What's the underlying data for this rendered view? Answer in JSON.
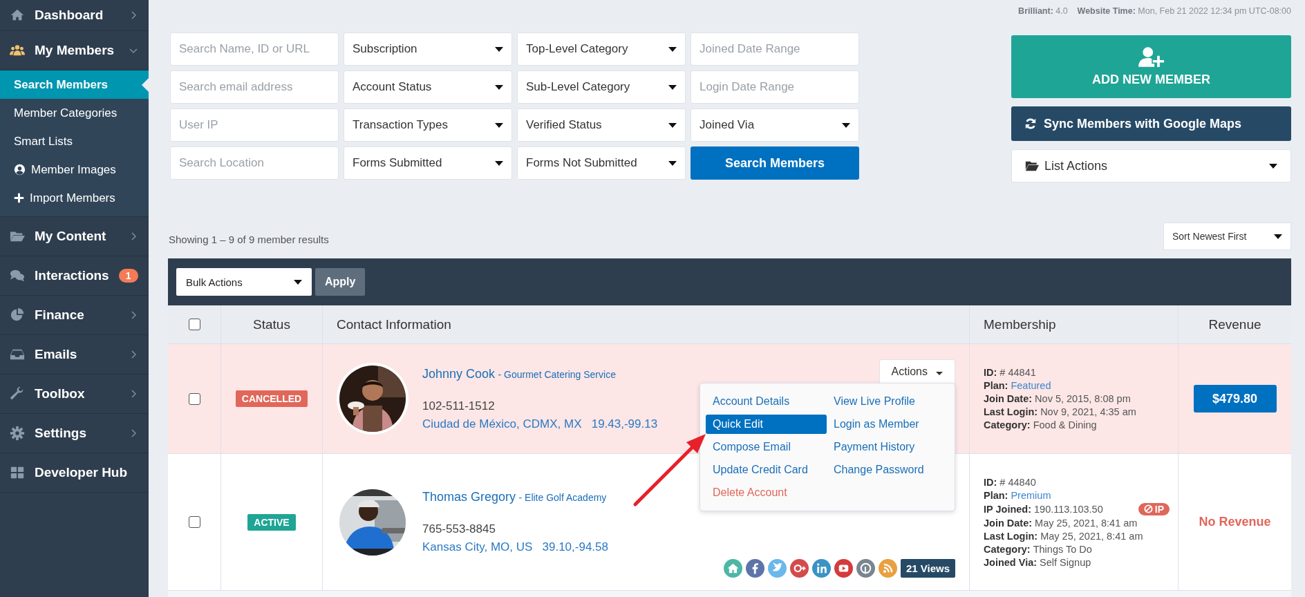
{
  "sidebar": {
    "items": [
      {
        "label": "Dashboard",
        "kind": "menu",
        "expanded": false,
        "selected": false
      },
      {
        "label": "My Members",
        "kind": "menu",
        "expanded": true,
        "selected": false,
        "children": [
          {
            "label": "Search Members",
            "selected": true
          },
          {
            "label": "Member Categories",
            "selected": false
          },
          {
            "label": "Smart Lists",
            "selected": false
          },
          {
            "label": "Member Images",
            "selected": false
          },
          {
            "label": "Import Members",
            "selected": false
          }
        ]
      },
      {
        "label": "My Content",
        "kind": "menu",
        "expanded": false,
        "selected": false
      },
      {
        "label": "Interactions",
        "kind": "link",
        "badge": "1",
        "selected": false
      },
      {
        "label": "Finance",
        "kind": "menu",
        "expanded": false,
        "selected": false
      },
      {
        "label": "Emails",
        "kind": "menu",
        "expanded": false,
        "selected": false
      },
      {
        "label": "Toolbox",
        "kind": "menu",
        "expanded": false,
        "selected": false
      },
      {
        "label": "Settings",
        "kind": "menu",
        "expanded": false,
        "selected": false
      },
      {
        "label": "Developer Hub",
        "kind": "link",
        "selected": false
      }
    ]
  },
  "top_info": {
    "version_label": "Brilliant:",
    "version": "4.0",
    "time_label": "Website Time:",
    "time": "Mon, Feb 21 2022 12:34 pm UTC-08:00"
  },
  "filters": [
    {
      "kind": "input",
      "placeholder": "Search Name, ID or URL"
    },
    {
      "kind": "select",
      "value": "Subscription"
    },
    {
      "kind": "select",
      "value": "Top-Level Category"
    },
    {
      "kind": "input",
      "placeholder": "Joined Date Range"
    },
    {
      "kind": "input",
      "placeholder": "Search email address"
    },
    {
      "kind": "select",
      "value": "Account Status"
    },
    {
      "kind": "select",
      "value": "Sub-Level Category"
    },
    {
      "kind": "input",
      "placeholder": "Login Date Range"
    },
    {
      "kind": "input",
      "placeholder": "User IP"
    },
    {
      "kind": "select",
      "value": "Transaction Types"
    },
    {
      "kind": "select",
      "value": "Verified Status"
    },
    {
      "kind": "select",
      "value": "Joined Via"
    },
    {
      "kind": "input",
      "placeholder": "Search Location"
    },
    {
      "kind": "select",
      "value": "Forms Submitted"
    },
    {
      "kind": "select",
      "value": "Forms Not Submitted"
    },
    {
      "kind": "button",
      "label": "Search Members"
    }
  ],
  "actions": {
    "add": "ADD NEW MEMBER",
    "sync": "Sync Members with Google Maps",
    "list": "List Actions"
  },
  "results": "Showing 1 – 9 of 9 member results",
  "sort": "Sort Newest First",
  "bulk": {
    "value": "Bulk Actions",
    "apply": "Apply"
  },
  "table": {
    "select_all": {
      "checked": false
    },
    "columns": [
      "Status",
      "Contact Information",
      "Membership",
      "Revenue"
    ],
    "rows": [
      {
        "checked": false,
        "highlighted": true,
        "status": "CANCELLED",
        "color": "#e0675a",
        "name": "Johnny Cook",
        "company": "- Gourmet Catering Service",
        "phone": "102-511-1512",
        "location": "Ciudad de México, CDMX, MX",
        "coords": "19.43,-99.13",
        "actions": "Actions",
        "membership": [
          {
            "label": "ID:",
            "value": "# 44841",
            "kind": "text"
          },
          {
            "label": "Plan:",
            "value": "Featured",
            "kind": "link"
          },
          {
            "label": "Join Date:",
            "value": "Nov 5, 2015, 8:08 pm",
            "kind": "text"
          },
          {
            "label": "Last Login:",
            "value": "Nov 9, 2021, 4:35 am",
            "kind": "text"
          },
          {
            "label": "Category:",
            "value": "Food & Dining",
            "kind": "text"
          }
        ],
        "revenue": {
          "kind": "button",
          "text": "$479.80"
        },
        "menu": [
          {
            "label": "Account Details",
            "kind": "link",
            "selected": false
          },
          {
            "label": "View Live Profile",
            "kind": "link",
            "selected": false
          },
          {
            "label": "Quick Edit",
            "kind": "link",
            "selected": true
          },
          {
            "label": "Login as Member",
            "kind": "link",
            "selected": false
          },
          {
            "label": "Compose Email",
            "kind": "link",
            "selected": false
          },
          {
            "label": "Payment History",
            "kind": "link",
            "selected": false
          },
          {
            "label": "Update Credit Card",
            "kind": "link",
            "selected": false
          },
          {
            "label": "Change Password",
            "kind": "link",
            "selected": false
          },
          {
            "label": "Delete Account",
            "kind": "danger",
            "selected": false
          }
        ]
      },
      {
        "checked": false,
        "highlighted": false,
        "status": "ACTIVE",
        "color": "#1fa595",
        "name": "Thomas Gregory",
        "company": "- Elite Golf Academy",
        "phone": "765-553-8845",
        "location": "Kansas City, MO, US",
        "coords": "39.10,-94.58",
        "views": "21 Views",
        "membership": [
          {
            "label": "ID:",
            "value": "# 44840",
            "kind": "text"
          },
          {
            "label": "Plan:",
            "value": "Premium",
            "kind": "link"
          },
          {
            "label": "IP Joined:",
            "value": "190.113.103.50",
            "kind": "text",
            "badge": "IP"
          },
          {
            "label": "Join Date:",
            "value": "May 25, 2021, 8:41 am",
            "kind": "text"
          },
          {
            "label": "Last Login:",
            "value": "May 25, 2021, 8:41 am",
            "kind": "text"
          },
          {
            "label": "Category:",
            "value": "Things To Do",
            "kind": "text"
          },
          {
            "label": "Joined Via:",
            "value": "Self Signup",
            "kind": "text"
          }
        ],
        "revenue": {
          "kind": "none",
          "text": "No Revenue"
        }
      }
    ]
  }
}
